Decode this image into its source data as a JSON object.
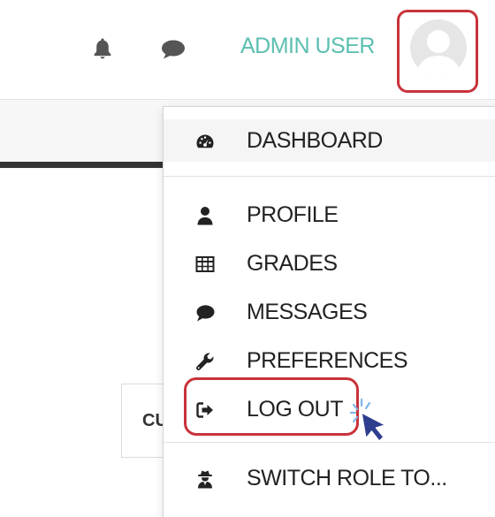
{
  "navbar": {
    "user_name": "ADMIN USER",
    "icons": {
      "notifications": "bell-icon",
      "messages": "chat-bubble-icon",
      "avatar": "user-avatar"
    },
    "accent_color": "#5bbfb0"
  },
  "page": {
    "partial_label": "CU"
  },
  "user_menu": {
    "items": [
      {
        "label": "DASHBOARD",
        "icon": "dashboard-gauge-icon"
      },
      {
        "label": "PROFILE",
        "icon": "user-icon"
      },
      {
        "label": "GRADES",
        "icon": "table-grid-icon"
      },
      {
        "label": "MESSAGES",
        "icon": "chat-bubble-icon"
      },
      {
        "label": "PREFERENCES",
        "icon": "wrench-icon"
      },
      {
        "label": "LOG OUT",
        "icon": "sign-out-icon"
      },
      {
        "label": "SWITCH ROLE TO...",
        "icon": "user-secret-icon"
      }
    ],
    "highlight_color": "#c8333a"
  },
  "annotation": {
    "cursor": "mouse-pointer-click-icon",
    "cursor_color": "#2f3d8f",
    "click_burst_color": "#7fb6e8"
  }
}
